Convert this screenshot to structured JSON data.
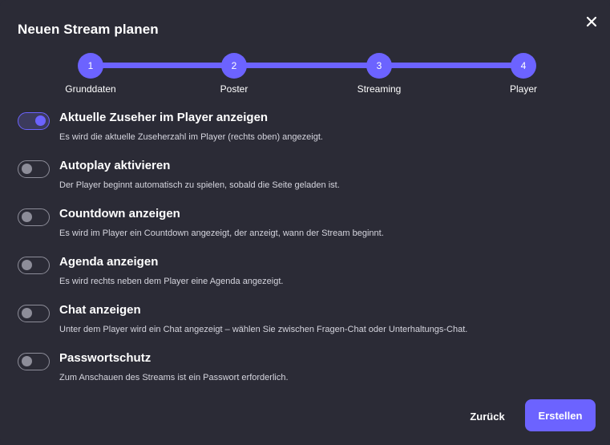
{
  "dialog": {
    "title": "Neuen Stream planen",
    "close_icon": "close-icon"
  },
  "stepper": {
    "current_step": 4,
    "steps": [
      {
        "number": "1",
        "label": "Grunddaten"
      },
      {
        "number": "2",
        "label": "Poster"
      },
      {
        "number": "3",
        "label": "Streaming"
      },
      {
        "number": "4",
        "label": "Player"
      }
    ]
  },
  "options": [
    {
      "title": "Aktuelle Zuseher im Player anzeigen",
      "description": "Es wird die aktuelle Zuseherzahl im Player (rechts oben) angezeigt.",
      "enabled": true
    },
    {
      "title": "Autoplay aktivieren",
      "description": "Der Player beginnt automatisch zu spielen, sobald die Seite geladen ist.",
      "enabled": false
    },
    {
      "title": "Countdown anzeigen",
      "description": "Es wird im Player ein Countdown angezeigt, der anzeigt, wann der Stream beginnt.",
      "enabled": false
    },
    {
      "title": "Agenda anzeigen",
      "description": "Es wird rechts neben dem Player eine Agenda angezeigt.",
      "enabled": false
    },
    {
      "title": "Chat anzeigen",
      "description": "Unter dem Player wird ein Chat angezeigt – wählen Sie zwischen Fragen-Chat oder Unterhaltungs-Chat.",
      "enabled": false
    },
    {
      "title": "Passwortschutz",
      "description": "Zum Anschauen des Streams ist ein Passwort erforderlich.",
      "enabled": false
    }
  ],
  "footer": {
    "back_label": "Zurück",
    "create_label": "Erstellen"
  },
  "colors": {
    "background": "#2b2b36",
    "accent": "#6c63ff",
    "toggle_off": "#8d8d99",
    "text": "#ffffff",
    "muted_text": "#d5d5de"
  }
}
